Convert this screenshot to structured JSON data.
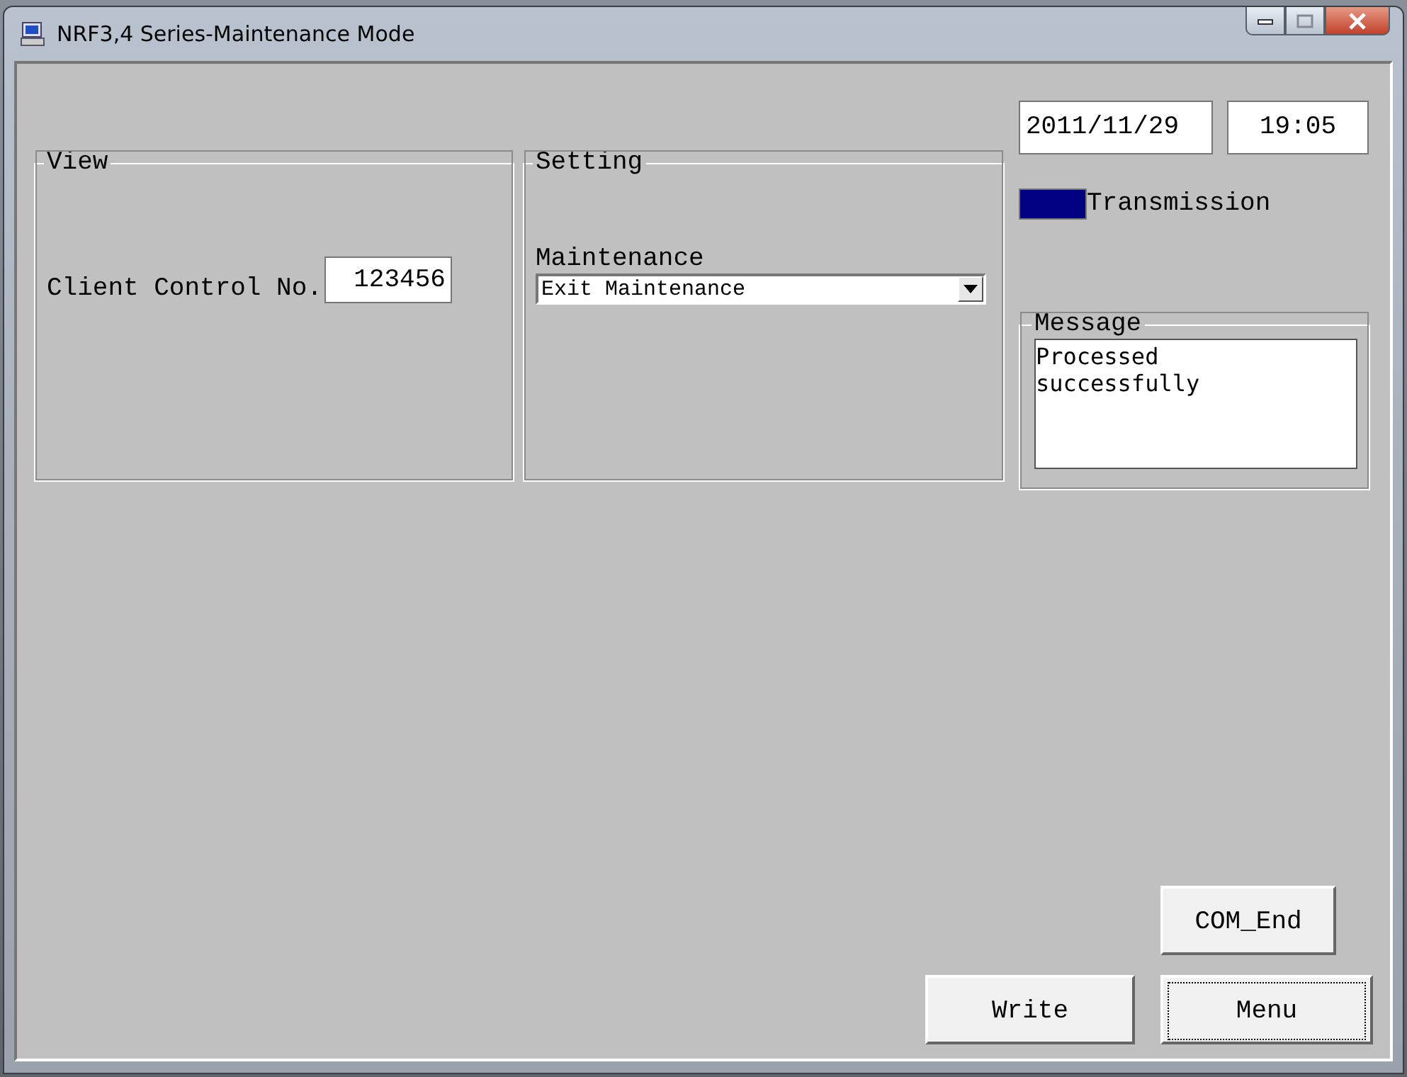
{
  "window": {
    "title": "NRF3,4 Series-Maintenance Mode"
  },
  "view": {
    "legend": "View",
    "client_control_label": "Client Control No.",
    "client_control_value": "123456"
  },
  "setting": {
    "legend": "Setting",
    "maintenance_label": "Maintenance",
    "maintenance_value": "Exit Maintenance"
  },
  "date": "2011/11/29",
  "time": "19:05",
  "transmission": {
    "label": "Transmission",
    "on": true
  },
  "message": {
    "legend": "Message",
    "text": "Processed successfully"
  },
  "buttons": [
    {
      "label": "COM_End",
      "focused": false
    },
    {
      "label": "Write",
      "focused": false
    },
    {
      "label": "Menu",
      "focused": true
    }
  ]
}
